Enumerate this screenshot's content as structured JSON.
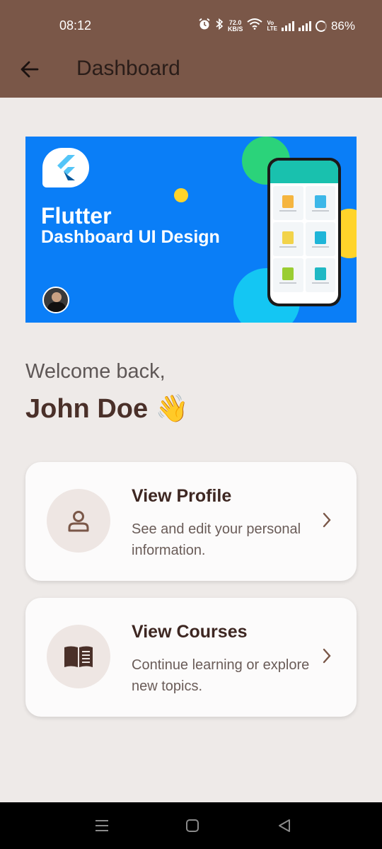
{
  "status_bar": {
    "time": "08:12",
    "net_speed_value": "72.0",
    "net_speed_unit": "KB/S",
    "volte_top": "Vo",
    "volte_bottom": "LTE",
    "battery": "86%",
    "icons": [
      "alarm-icon",
      "bluetooth-icon",
      "wifi-icon",
      "signal-icon",
      "battery-icon"
    ]
  },
  "app_bar": {
    "title": "Dashboard",
    "back_icon": "arrow-left-icon",
    "color": "#7A5748"
  },
  "banner": {
    "title": "Flutter",
    "subtitle": "Dashboard UI Design",
    "background": "#0A7EF7"
  },
  "welcome": {
    "greeting": "Welcome back,",
    "name": "John Doe 👋"
  },
  "cards": [
    {
      "title": "View Profile",
      "description": "See and edit your personal information.",
      "icon": "person-icon"
    },
    {
      "title": "View Courses",
      "description": "Continue learning or explore new topics.",
      "icon": "book-icon"
    }
  ],
  "nav_bar": {
    "icons": [
      "menu-icon",
      "home-square-icon",
      "back-triangle-icon"
    ]
  }
}
